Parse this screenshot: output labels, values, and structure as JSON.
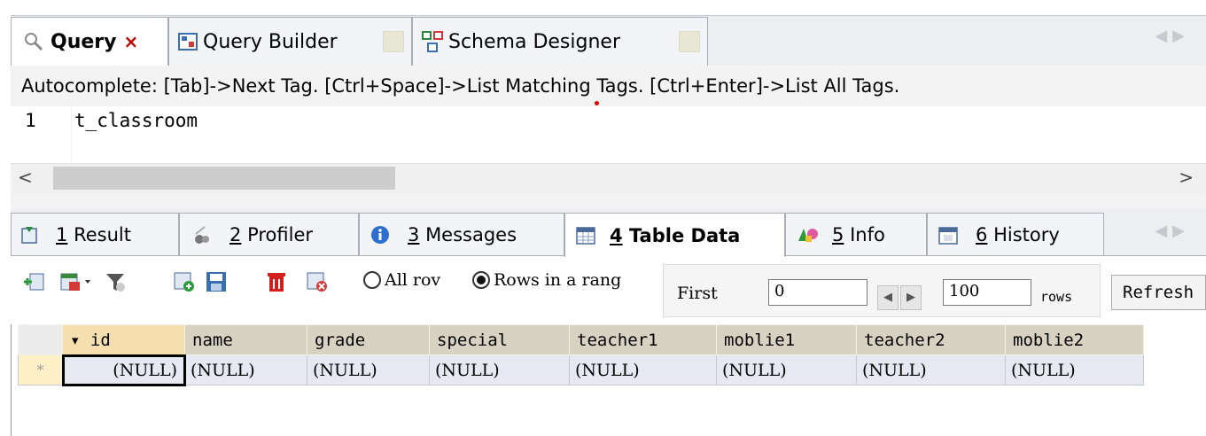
{
  "query_tabs": [
    {
      "label": "Query",
      "close": "×",
      "active": true
    },
    {
      "label": "Query Builder",
      "active": false
    },
    {
      "label": "Schema Designer",
      "active": false
    }
  ],
  "hint": "Autocomplete: [Tab]->Next Tag. [Ctrl+Space]->List Matching Tags. [Ctrl+Enter]->List All Tags.",
  "editor": {
    "line_number": "1",
    "line_text": "t_classroom"
  },
  "scrollbar": {
    "left": "<",
    "right": ">"
  },
  "tab_nav": "◀▶",
  "result_tabs": [
    {
      "num": "1",
      "text": "Result"
    },
    {
      "num": "2",
      "text": "Profiler"
    },
    {
      "num": "3",
      "text": "Messages"
    },
    {
      "num": "4",
      "text": "Table Data"
    },
    {
      "num": "5",
      "text": "Info"
    },
    {
      "num": "6",
      "text": "History"
    }
  ],
  "toolbar": {
    "all_rows_label": "All rov",
    "range_label": "Rows in a rang",
    "first_label": "First",
    "first_value": "0",
    "count_value": "100",
    "rows_label": "rows",
    "refresh_label": "Refresh",
    "prev_glyph": "◀",
    "next_glyph": "▶"
  },
  "grid": {
    "columns": [
      "▾ id",
      "name",
      "grade",
      "special",
      "teacher1",
      "moblie1",
      "teacher2",
      "moblie2"
    ],
    "new_row_marker": "*",
    "rows": [
      [
        "(NULL)",
        "(NULL)",
        "(NULL)",
        "(NULL)",
        "(NULL)",
        "(NULL)",
        "(NULL)",
        "(NULL)"
      ]
    ]
  },
  "colors": {
    "accent_close": "#c00000",
    "header_bg": "#d7d2c2",
    "row_bg": "#e6e8f2"
  }
}
